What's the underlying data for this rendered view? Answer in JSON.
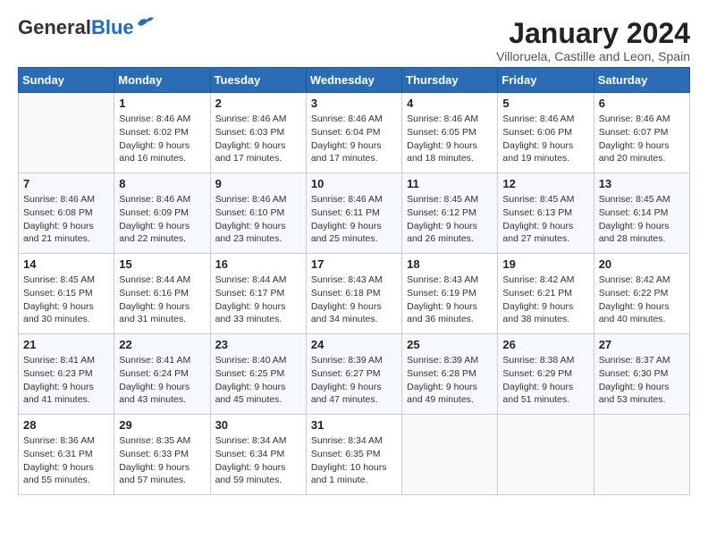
{
  "header": {
    "logo_general": "General",
    "logo_blue": "Blue",
    "title": "January 2024",
    "location": "Villoruela, Castille and Leon, Spain"
  },
  "weekdays": [
    "Sunday",
    "Monday",
    "Tuesday",
    "Wednesday",
    "Thursday",
    "Friday",
    "Saturday"
  ],
  "weeks": [
    [
      {
        "day": "",
        "sunrise": "",
        "sunset": "",
        "daylight": "",
        "empty": true
      },
      {
        "day": "1",
        "sunrise": "Sunrise: 8:46 AM",
        "sunset": "Sunset: 6:02 PM",
        "daylight": "Daylight: 9 hours and 16 minutes."
      },
      {
        "day": "2",
        "sunrise": "Sunrise: 8:46 AM",
        "sunset": "Sunset: 6:03 PM",
        "daylight": "Daylight: 9 hours and 17 minutes."
      },
      {
        "day": "3",
        "sunrise": "Sunrise: 8:46 AM",
        "sunset": "Sunset: 6:04 PM",
        "daylight": "Daylight: 9 hours and 17 minutes."
      },
      {
        "day": "4",
        "sunrise": "Sunrise: 8:46 AM",
        "sunset": "Sunset: 6:05 PM",
        "daylight": "Daylight: 9 hours and 18 minutes."
      },
      {
        "day": "5",
        "sunrise": "Sunrise: 8:46 AM",
        "sunset": "Sunset: 6:06 PM",
        "daylight": "Daylight: 9 hours and 19 minutes."
      },
      {
        "day": "6",
        "sunrise": "Sunrise: 8:46 AM",
        "sunset": "Sunset: 6:07 PM",
        "daylight": "Daylight: 9 hours and 20 minutes."
      }
    ],
    [
      {
        "day": "7",
        "sunrise": "Sunrise: 8:46 AM",
        "sunset": "Sunset: 6:08 PM",
        "daylight": "Daylight: 9 hours and 21 minutes."
      },
      {
        "day": "8",
        "sunrise": "Sunrise: 8:46 AM",
        "sunset": "Sunset: 6:09 PM",
        "daylight": "Daylight: 9 hours and 22 minutes."
      },
      {
        "day": "9",
        "sunrise": "Sunrise: 8:46 AM",
        "sunset": "Sunset: 6:10 PM",
        "daylight": "Daylight: 9 hours and 23 minutes."
      },
      {
        "day": "10",
        "sunrise": "Sunrise: 8:46 AM",
        "sunset": "Sunset: 6:11 PM",
        "daylight": "Daylight: 9 hours and 25 minutes."
      },
      {
        "day": "11",
        "sunrise": "Sunrise: 8:45 AM",
        "sunset": "Sunset: 6:12 PM",
        "daylight": "Daylight: 9 hours and 26 minutes."
      },
      {
        "day": "12",
        "sunrise": "Sunrise: 8:45 AM",
        "sunset": "Sunset: 6:13 PM",
        "daylight": "Daylight: 9 hours and 27 minutes."
      },
      {
        "day": "13",
        "sunrise": "Sunrise: 8:45 AM",
        "sunset": "Sunset: 6:14 PM",
        "daylight": "Daylight: 9 hours and 28 minutes."
      }
    ],
    [
      {
        "day": "14",
        "sunrise": "Sunrise: 8:45 AM",
        "sunset": "Sunset: 6:15 PM",
        "daylight": "Daylight: 9 hours and 30 minutes."
      },
      {
        "day": "15",
        "sunrise": "Sunrise: 8:44 AM",
        "sunset": "Sunset: 6:16 PM",
        "daylight": "Daylight: 9 hours and 31 minutes."
      },
      {
        "day": "16",
        "sunrise": "Sunrise: 8:44 AM",
        "sunset": "Sunset: 6:17 PM",
        "daylight": "Daylight: 9 hours and 33 minutes."
      },
      {
        "day": "17",
        "sunrise": "Sunrise: 8:43 AM",
        "sunset": "Sunset: 6:18 PM",
        "daylight": "Daylight: 9 hours and 34 minutes."
      },
      {
        "day": "18",
        "sunrise": "Sunrise: 8:43 AM",
        "sunset": "Sunset: 6:19 PM",
        "daylight": "Daylight: 9 hours and 36 minutes."
      },
      {
        "day": "19",
        "sunrise": "Sunrise: 8:42 AM",
        "sunset": "Sunset: 6:21 PM",
        "daylight": "Daylight: 9 hours and 38 minutes."
      },
      {
        "day": "20",
        "sunrise": "Sunrise: 8:42 AM",
        "sunset": "Sunset: 6:22 PM",
        "daylight": "Daylight: 9 hours and 40 minutes."
      }
    ],
    [
      {
        "day": "21",
        "sunrise": "Sunrise: 8:41 AM",
        "sunset": "Sunset: 6:23 PM",
        "daylight": "Daylight: 9 hours and 41 minutes."
      },
      {
        "day": "22",
        "sunrise": "Sunrise: 8:41 AM",
        "sunset": "Sunset: 6:24 PM",
        "daylight": "Daylight: 9 hours and 43 minutes."
      },
      {
        "day": "23",
        "sunrise": "Sunrise: 8:40 AM",
        "sunset": "Sunset: 6:25 PM",
        "daylight": "Daylight: 9 hours and 45 minutes."
      },
      {
        "day": "24",
        "sunrise": "Sunrise: 8:39 AM",
        "sunset": "Sunset: 6:27 PM",
        "daylight": "Daylight: 9 hours and 47 minutes."
      },
      {
        "day": "25",
        "sunrise": "Sunrise: 8:39 AM",
        "sunset": "Sunset: 6:28 PM",
        "daylight": "Daylight: 9 hours and 49 minutes."
      },
      {
        "day": "26",
        "sunrise": "Sunrise: 8:38 AM",
        "sunset": "Sunset: 6:29 PM",
        "daylight": "Daylight: 9 hours and 51 minutes."
      },
      {
        "day": "27",
        "sunrise": "Sunrise: 8:37 AM",
        "sunset": "Sunset: 6:30 PM",
        "daylight": "Daylight: 9 hours and 53 minutes."
      }
    ],
    [
      {
        "day": "28",
        "sunrise": "Sunrise: 8:36 AM",
        "sunset": "Sunset: 6:31 PM",
        "daylight": "Daylight: 9 hours and 55 minutes."
      },
      {
        "day": "29",
        "sunrise": "Sunrise: 8:35 AM",
        "sunset": "Sunset: 6:33 PM",
        "daylight": "Daylight: 9 hours and 57 minutes."
      },
      {
        "day": "30",
        "sunrise": "Sunrise: 8:34 AM",
        "sunset": "Sunset: 6:34 PM",
        "daylight": "Daylight: 9 hours and 59 minutes."
      },
      {
        "day": "31",
        "sunrise": "Sunrise: 8:34 AM",
        "sunset": "Sunset: 6:35 PM",
        "daylight": "Daylight: 10 hours and 1 minute."
      },
      {
        "day": "",
        "sunrise": "",
        "sunset": "",
        "daylight": "",
        "empty": true
      },
      {
        "day": "",
        "sunrise": "",
        "sunset": "",
        "daylight": "",
        "empty": true
      },
      {
        "day": "",
        "sunrise": "",
        "sunset": "",
        "daylight": "",
        "empty": true
      }
    ]
  ]
}
